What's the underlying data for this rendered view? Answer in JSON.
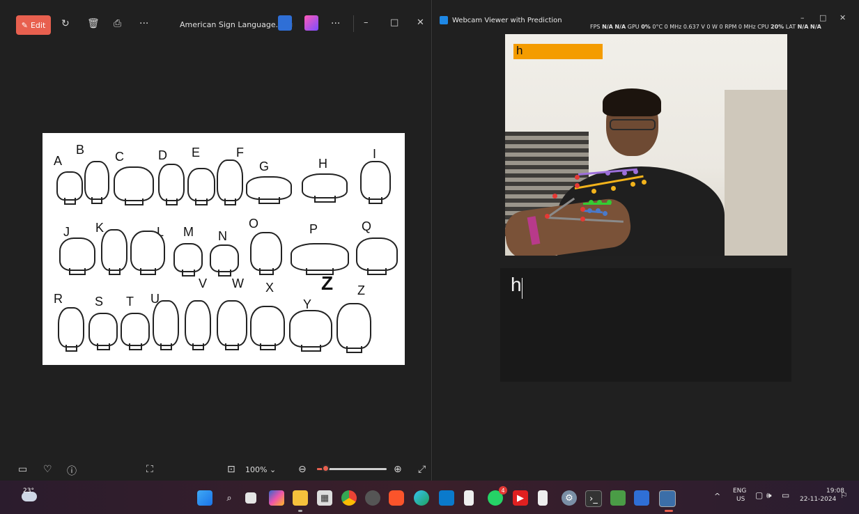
{
  "photos": {
    "edit_label": "Edit",
    "file_title": "American Sign Language.png",
    "zoom": "100%",
    "zoom_fraction": 0.12,
    "letters": [
      "A",
      "B",
      "C",
      "D",
      "E",
      "F",
      "G",
      "H",
      "I",
      "J",
      "K",
      "L",
      "M",
      "N",
      "O",
      "P",
      "Q",
      "R",
      "S",
      "T",
      "U",
      "V",
      "W",
      "X",
      "Y",
      "Z",
      "Z"
    ],
    "window_controls": {
      "minimize": "–",
      "maximize": "□",
      "close": "✕"
    }
  },
  "webcam": {
    "title": "Webcam Viewer with Prediction",
    "stats": {
      "fps_label": "FPS",
      "fps_val": "N/A",
      "fps_val2": "N/A",
      "gpu_label": "GPU",
      "gpu_val": "0%",
      "temp": "0°C",
      "mhz": "0 MHz",
      "volt": "0.637 V",
      "watt": "0 W",
      "rpm": "0 RPM",
      "mhz2": "0 MHz",
      "cpu_label": "CPU",
      "cpu_val": "20%",
      "lat_label": "LAT",
      "lat_val": "N/A",
      "last_val": "N/A"
    },
    "prediction": "h",
    "output_text": "h",
    "window_controls": {
      "minimize": "–",
      "maximize": "□",
      "close": "✕"
    }
  },
  "taskbar": {
    "weather_temp": "23°",
    "lang_top": "ENG",
    "lang_bottom": "US",
    "time": "19:08",
    "date": "22-11-2024",
    "whatsapp_badge": "4",
    "apps": [
      "start",
      "search",
      "task-view",
      "copilot",
      "file-explorer",
      "calendar",
      "chrome",
      "app-generic",
      "brave",
      "edge",
      "vscode",
      "notepad",
      "whatsapp",
      "youtube",
      "notepad-2",
      "settings",
      "terminal",
      "camera",
      "photos",
      "python"
    ]
  },
  "colors": {
    "accent": "#e8604f",
    "prediction_box": "#f49c00",
    "bg": "#202020"
  }
}
